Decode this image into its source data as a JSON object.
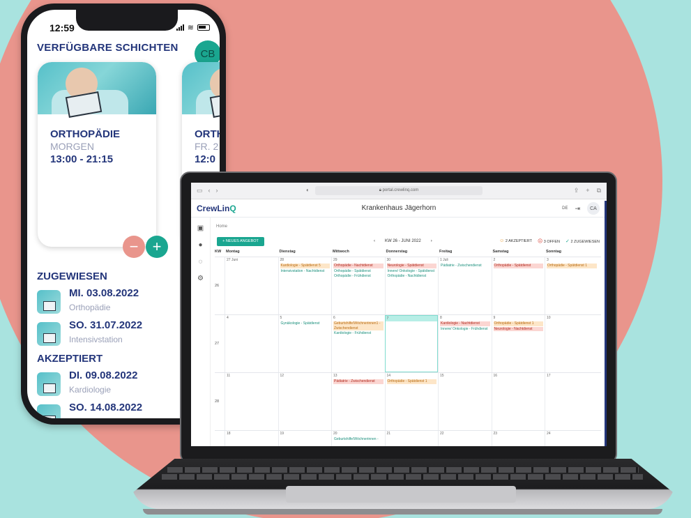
{
  "phone": {
    "status_time": "12:59",
    "title": "VERFÜGBARE SCHICHTEN",
    "avatar": "CB",
    "cards": [
      {
        "dept": "ORTHOPÄDIE",
        "label": "MORGEN",
        "hours": "13:00 - 21:15"
      },
      {
        "dept": "ORTH",
        "label": "FR. 2",
        "hours": "12:0"
      }
    ],
    "assigned": {
      "heading": "ZUGEWIESEN",
      "items": [
        {
          "date": "MI. 03.08.2022",
          "dept": "Orthopädie"
        },
        {
          "date": "SO. 31.07.2022",
          "dept": "Intensivstation"
        }
      ]
    },
    "accepted": {
      "heading": "AKZEPTIERT",
      "items": [
        {
          "date": "DI. 09.08.2022",
          "dept": "Kardiologie"
        },
        {
          "date": "SO. 14.08.2022",
          "dept": ""
        }
      ]
    }
  },
  "browser": {
    "url": "portal.crewlinq.com"
  },
  "app": {
    "brand": "CrewLin",
    "brand_accent": "Q",
    "hospital": "Krankenhaus Jägerhorn",
    "lang": "DE",
    "avatar": "CA",
    "breadcrumb": "Home",
    "new_offer_button": "+ NEUES ANGEBOT",
    "week_label": "KW 26 - JUNI 2022",
    "stats": {
      "accepted": "2 AKZEPTIERT",
      "open": "3 OFFEN",
      "assigned": "2 ZUGEWIESEN"
    },
    "calendar": {
      "kw_header": "KW",
      "days": [
        "Montag",
        "Dienstag",
        "Mittwoch",
        "Donnerstag",
        "Freitag",
        "Samstag",
        "Sonntag"
      ],
      "weeks": [
        {
          "kw": "26",
          "cells": [
            {
              "date": "27 Juni",
              "events": []
            },
            {
              "date": "28",
              "events": [
                {
                  "text": "Kardiologie - Spätdienst 5",
                  "tone": "org"
                },
                {
                  "text": "Intensivstation - Nachtdienst",
                  "tone": "grn"
                }
              ]
            },
            {
              "date": "29",
              "events": [
                {
                  "text": "Orthopädie - Nachtdienst",
                  "tone": "red"
                },
                {
                  "text": "Orthopädie - Spätdienst",
                  "tone": "grn"
                },
                {
                  "text": "Orthopädie - Frühdienst",
                  "tone": "grn"
                }
              ]
            },
            {
              "date": "30",
              "events": [
                {
                  "text": "Neurologie - Spätdienst",
                  "tone": "red"
                },
                {
                  "text": "Innere/ Onkologie - Spätdienst",
                  "tone": "grn"
                },
                {
                  "text": "Orthopädie - Nachtdienst",
                  "tone": "grn"
                }
              ]
            },
            {
              "date": "1 Juli",
              "events": [
                {
                  "text": "Pädiatrie - Zwischendienst",
                  "tone": "grn"
                }
              ]
            },
            {
              "date": "2",
              "events": [
                {
                  "text": "Orthopädie - Spätdienst",
                  "tone": "red"
                }
              ]
            },
            {
              "date": "3",
              "events": [
                {
                  "text": "Orthopädie - Spätdienst 1",
                  "tone": "org"
                }
              ]
            }
          ]
        },
        {
          "kw": "27",
          "cells": [
            {
              "date": "4",
              "events": []
            },
            {
              "date": "5",
              "events": [
                {
                  "text": "Gynäkologie - Spätdienst",
                  "tone": "grn"
                }
              ]
            },
            {
              "date": "6",
              "events": [
                {
                  "text": "Geburtshilfe/Wöchnerinnen1 - Zwischendienst",
                  "tone": "org"
                },
                {
                  "text": "Kardiologie - Frühdienst",
                  "tone": "grn"
                }
              ]
            },
            {
              "date": "7",
              "events": [],
              "today": true
            },
            {
              "date": "8",
              "events": [
                {
                  "text": "Kardiologie - Nachtdienst",
                  "tone": "red"
                },
                {
                  "text": "Innere/ Onkologie - Frühdienst",
                  "tone": "grn"
                }
              ]
            },
            {
              "date": "9",
              "events": [
                {
                  "text": "Orthopädie - Spätdienst 1",
                  "tone": "org"
                },
                {
                  "text": "Neurologie - Nachtdienst",
                  "tone": "red"
                }
              ]
            },
            {
              "date": "10",
              "events": []
            }
          ]
        },
        {
          "kw": "28",
          "cells": [
            {
              "date": "11",
              "events": []
            },
            {
              "date": "12",
              "events": []
            },
            {
              "date": "13",
              "events": [
                {
                  "text": "Pädiatrie - Zwischendienst",
                  "tone": "red"
                }
              ]
            },
            {
              "date": "14",
              "events": [
                {
                  "text": "Orthopädie - Spätdienst 1",
                  "tone": "org"
                }
              ]
            },
            {
              "date": "15",
              "events": []
            },
            {
              "date": "16",
              "events": []
            },
            {
              "date": "17",
              "events": []
            }
          ]
        },
        {
          "kw": "",
          "cells": [
            {
              "date": "18",
              "events": []
            },
            {
              "date": "19",
              "events": []
            },
            {
              "date": "20",
              "events": [
                {
                  "text": "Geburtshilfe/Wöchnerinnen -",
                  "tone": "grn"
                }
              ]
            },
            {
              "date": "21",
              "events": []
            },
            {
              "date": "22",
              "events": []
            },
            {
              "date": "23",
              "events": []
            },
            {
              "date": "24",
              "events": []
            }
          ]
        }
      ]
    }
  }
}
